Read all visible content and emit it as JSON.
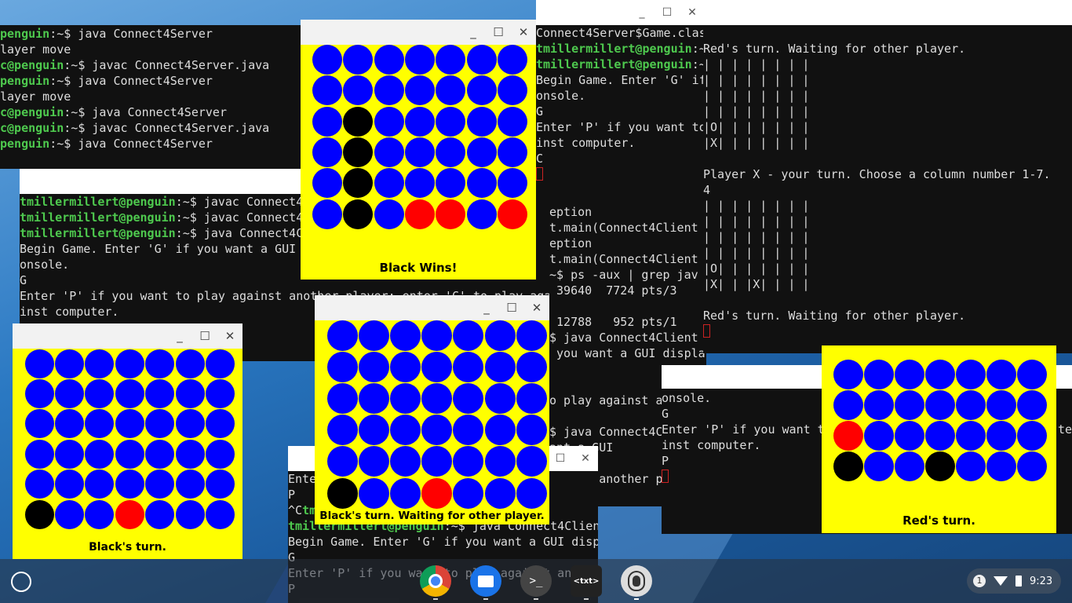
{
  "terminal_top_left": {
    "lines": [
      {
        "p": "penguin",
        "t": ":~$ java Connect4Server"
      },
      {
        "p": "",
        "t": "layer move"
      },
      {
        "p": "c@penguin",
        "t": ":~$ javac Connect4Server.java"
      },
      {
        "p": "penguin",
        "t": ":~$ java Connect4Server"
      },
      {
        "p": "",
        "t": "layer move"
      },
      {
        "p": "c@penguin",
        "t": ":~$ java Connect4Server"
      },
      {
        "p": "c@penguin",
        "t": ":~$ javac Connect4Server.java"
      },
      {
        "p": "penguin",
        "t": ":~$ java Connect4Server"
      }
    ]
  },
  "terminal_mid_left": {
    "lines": [
      {
        "p": "tmillermillert@penguin",
        "t": ":~$ javac Connect4"
      },
      {
        "p": "tmillermillert@penguin",
        "t": ":~$ javac Connect4"
      },
      {
        "p": "tmillermillert@penguin",
        "t": ":~$ java Connect4C"
      },
      {
        "p": "",
        "t": "Begin Game. Enter 'G' if you want a GUI"
      },
      {
        "p": "",
        "t": "onsole."
      },
      {
        "p": "",
        "t": "G"
      },
      {
        "p": "",
        "t": "Enter 'P' if you want to play against another player; enter 'C' to play aga"
      },
      {
        "p": "",
        "t": "inst computer."
      }
    ]
  },
  "terminal_center": {
    "lines": [
      {
        "p": "",
        "t": "Connect4Server$Game.clas"
      },
      {
        "p": "tmillermillert@penguin",
        "t": ":~"
      },
      {
        "p": "tmillermillert@penguin",
        "t": ":~"
      },
      {
        "p": "",
        "t": "Begin Game. Enter 'G' if"
      },
      {
        "p": "",
        "t": "onsole."
      },
      {
        "p": "",
        "t": "G"
      },
      {
        "p": "",
        "t": "Enter 'P' if you want to"
      },
      {
        "p": "",
        "t": "inst computer."
      },
      {
        "p": "",
        "t": "C"
      }
    ],
    "lower_lines": [
      "eption",
      "t.main(Connect4Client",
      "eption",
      "t.main(Connect4Client",
      "~$ ps -aux | grep jav",
      " 39640  7724 pts/3",
      "",
      " 12788   952 pts/1",
      "$ java Connect4Client",
      " you want a GUI display, enter 'T' to",
      "",
      "",
      "o play against an",
      "",
      "$ java Connect4C",
      "ant a GUI",
      "",
      "gainst another player; enter 'C"
    ]
  },
  "terminal_right": {
    "lines": [
      "Red's turn. Waiting for other player.",
      "| | | | | | | |",
      "| | | | | | | |",
      "| | | | | | | |",
      "| | | | | | | |",
      "|O| | | | | | |",
      "|X| | | | | | |",
      "",
      "Player X - your turn. Choose a column number 1-7.",
      "4",
      "| | | | | | | |",
      "| | | | | | | |",
      "| | | | | | | |",
      "| | | | | | | |",
      "|O| | | | | | |",
      "|X| | |X| | | |",
      "",
      "Red's turn. Waiting for other player."
    ]
  },
  "terminal_lower_right": {
    "lines": [
      "onsole.",
      "G",
      "Enter 'P' if you want t",
      "inst computer.",
      "P"
    ],
    "side_lines": [
      "te"
    ]
  },
  "terminal_bottom": {
    "lines": [
      {
        "p": "",
        "t": "Ente"
      },
      {
        "p": "",
        "t": "P"
      },
      {
        "p": "",
        "t": "^C",
        "p2": "tm"
      },
      {
        "p": "tmillermillert@penguin",
        "t": ":~$ java Connect4Clien"
      },
      {
        "p": "",
        "t": "Begin Game. Enter 'G' if you want a GUI disp"
      },
      {
        "p": "",
        "t": "G"
      },
      {
        "p": "",
        "t": "Enter 'P' if you want to play against ano"
      },
      {
        "p": "",
        "t": "P"
      }
    ],
    "side_lines": [
      " anothe",
      "",
      "ct4Clie"
    ]
  },
  "boards": {
    "board1": {
      "status": "Black Wins!",
      "grid": [
        "BBBBBBB",
        "BBBBBBB",
        "BKBBBBB",
        "BKBBBBB",
        "BKBBBBB",
        "BKBRRBR"
      ]
    },
    "board2": {
      "status": "Black's turn.",
      "grid": [
        "BBBBBBB",
        "BBBBBBB",
        "BBBBBBB",
        "BBBBBBB",
        "BBBBBBB",
        "KBBRBBB"
      ]
    },
    "board3": {
      "status": "Black's turn. Waiting for other player.",
      "grid": [
        "BBBBBBB",
        "BBBBBBB",
        "BBBBBBB",
        "BBBBBBB",
        "BBBBBBB",
        "KBBRBBB"
      ]
    },
    "board4": {
      "status": "Red's turn.",
      "grid": [
        "BBBBBBB",
        "BBBBBBB",
        "RBBBBBB",
        "KBBKBBB"
      ]
    }
  },
  "window_controls": {
    "minimize": "_",
    "maximize": "☐",
    "close": "✕"
  },
  "shelf": {
    "apps": [
      "Chrome",
      "Files",
      "Terminal",
      "Text",
      "Penguin"
    ],
    "terminal_glyph": ">_",
    "text_glyph": "<txt>",
    "notification_count": "1",
    "time": "9:23"
  }
}
